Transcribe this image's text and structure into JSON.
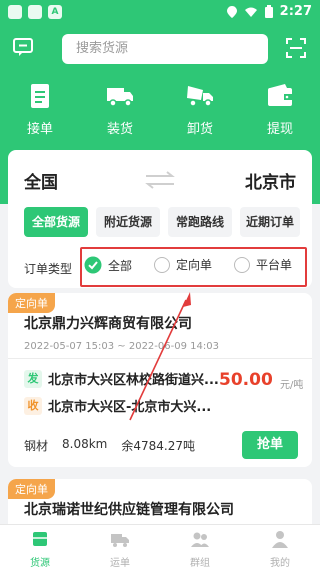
{
  "status_bar": {
    "time": "2:27"
  },
  "header": {
    "search_placeholder": "搜索货源",
    "quick_actions": [
      {
        "label": "接单",
        "icon": "clipboard-icon"
      },
      {
        "label": "装货",
        "icon": "truck-load-icon"
      },
      {
        "label": "卸货",
        "icon": "truck-unload-icon"
      },
      {
        "label": "提现",
        "icon": "wallet-icon"
      }
    ]
  },
  "route": {
    "from": "全国",
    "to": "北京市"
  },
  "tabs": [
    {
      "label": "全部货源",
      "active": true
    },
    {
      "label": "附近货源",
      "active": false
    },
    {
      "label": "常跑路线",
      "active": false
    },
    {
      "label": "近期订单",
      "active": false
    }
  ],
  "order_type": {
    "label": "订单类型",
    "options": [
      {
        "label": "全部",
        "selected": true
      },
      {
        "label": "定向单",
        "selected": false
      },
      {
        "label": "平台单",
        "selected": false
      }
    ]
  },
  "orders": [
    {
      "badge": "定向单",
      "company": "北京鼎力兴辉商贸有限公司",
      "date_range": "2022-05-07 15:03 ~ 2022-06-09 14:03",
      "from_tag": "发",
      "from_address": "北京市大兴区林校路街道兴...",
      "to_tag": "收",
      "to_address": "北京市大兴区-北京市大兴...",
      "price": "50.00",
      "unit": "元/吨",
      "cargo": "钢材",
      "distance": "8.08km",
      "remaining": "余4784.27吨",
      "action": "抢单"
    },
    {
      "badge": "定向单",
      "company": "北京瑞诺世纪供应链管理有限公司"
    }
  ],
  "tabbar": [
    {
      "label": "货源",
      "icon": "cargo-icon",
      "active": true
    },
    {
      "label": "运单",
      "icon": "waybill-truck-icon",
      "active": false
    },
    {
      "label": "群组",
      "icon": "group-icon",
      "active": false
    },
    {
      "label": "我的",
      "icon": "profile-icon",
      "active": false
    }
  ],
  "colors": {
    "primary": "#2ec776",
    "price": "#e8412b",
    "badge": "#f5a54b",
    "highlight": "#e23c3c"
  }
}
